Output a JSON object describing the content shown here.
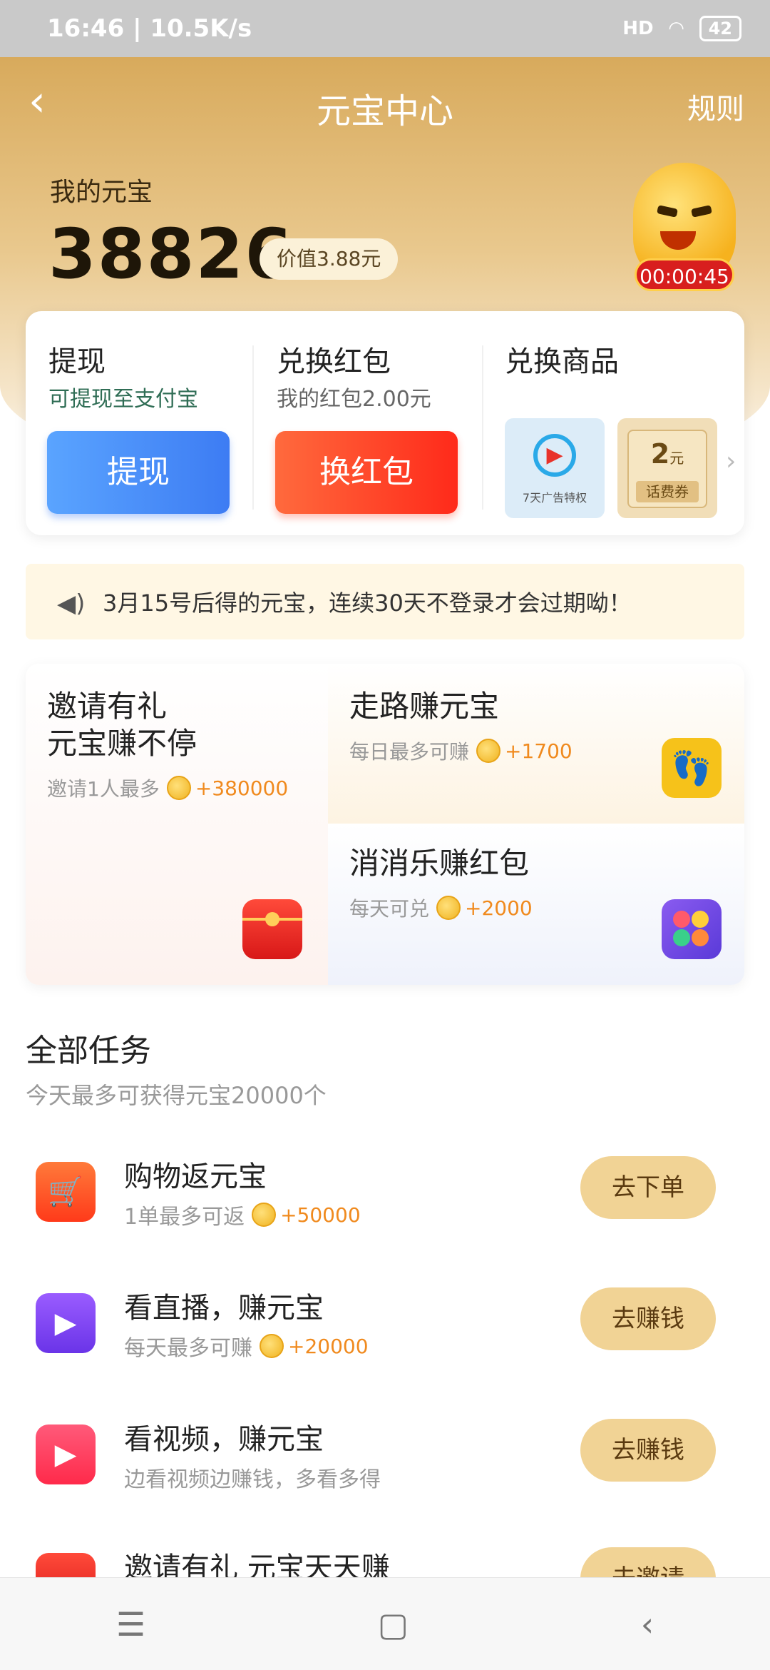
{
  "status_bar": {
    "time": "16:46 | 10.5K/s",
    "battery": "42",
    "signal": "HD"
  },
  "nav": {
    "back_symbol": "‹",
    "title": "元宝中心",
    "rules": "规则"
  },
  "wallet": {
    "label": "我的元宝",
    "balance": "38826",
    "value": "价值3.88元",
    "timer": "00:00:45"
  },
  "exchange_card": {
    "withdraw": {
      "title": "提现",
      "sub": "可提现至支付宝",
      "button": "提现"
    },
    "redpacket": {
      "title": "兑换红包",
      "sub": "我的红包2.00元",
      "button": "换红包"
    },
    "goods": {
      "title": "兑换商品",
      "item1": "7天广告特权",
      "item2_amount": "2",
      "item2_unit": "元",
      "item2_label": "话费券"
    }
  },
  "notice": "3月15号后得的元宝，连续30天不登录才会过期呦！",
  "promo": {
    "invite": {
      "title1": "邀请有礼",
      "title2": "元宝赚不停",
      "sub": "邀请1人最多",
      "reward": "+380000"
    },
    "walk": {
      "title": "走路赚元宝",
      "sub": "每日最多可赚",
      "reward": "+1700"
    },
    "match": {
      "title": "消消乐赚红包",
      "sub": "每天可兑",
      "reward": "+2000"
    }
  },
  "tasks_section": {
    "title": "全部任务",
    "sub": "今天最多可获得元宝20000个"
  },
  "tasks": [
    {
      "title": "购物返元宝",
      "sub": "1单最多可返",
      "reward": "+50000",
      "button": "去下单"
    },
    {
      "title": "看直播，赚元宝",
      "sub": "每天最多可赚",
      "reward": "+20000",
      "button": "去赚钱"
    },
    {
      "title": "看视频，赚元宝",
      "sub": "边看视频边赚钱，多看多得",
      "reward": "",
      "button": "去赚钱"
    },
    {
      "title": "邀请有礼 元宝天天赚",
      "sub": "",
      "reward": "",
      "button": "去邀请"
    }
  ],
  "colors": {
    "brand_gold": "#d8aa5c",
    "withdraw_blue": "#3d7cf3",
    "redpacket_red": "#ff2a1a",
    "task_button": "#f1d395"
  },
  "icons": [
    "back-icon",
    "speaker-icon",
    "footprints-icon",
    "game-icon",
    "cart-icon",
    "play-icon",
    "video-icon",
    "red-envelope-icon"
  ]
}
